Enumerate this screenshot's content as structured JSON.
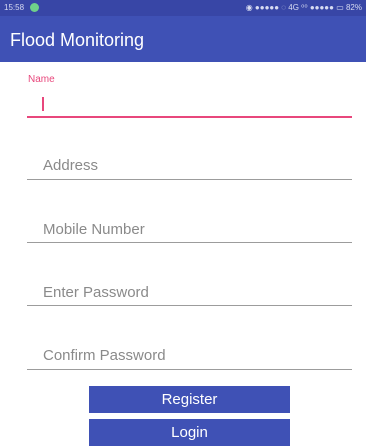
{
  "status_bar": {
    "time": "15:58",
    "right_text": "◉ ●●●●● ◌ 4G ⁰⁰ ●●●●● ▭ 82%"
  },
  "app_bar": {
    "title": "Flood Monitoring"
  },
  "form": {
    "name": {
      "label": "Name",
      "value": ""
    },
    "address": {
      "placeholder": "Address"
    },
    "mobile": {
      "placeholder": "Mobile Number"
    },
    "password": {
      "placeholder": "Enter Password"
    },
    "confirm": {
      "placeholder": "Confirm Password"
    }
  },
  "buttons": {
    "register": "Register",
    "login": "Login"
  },
  "colors": {
    "primary": "#3f51b5",
    "accent": "#e8477c",
    "status": "#3846a6"
  }
}
